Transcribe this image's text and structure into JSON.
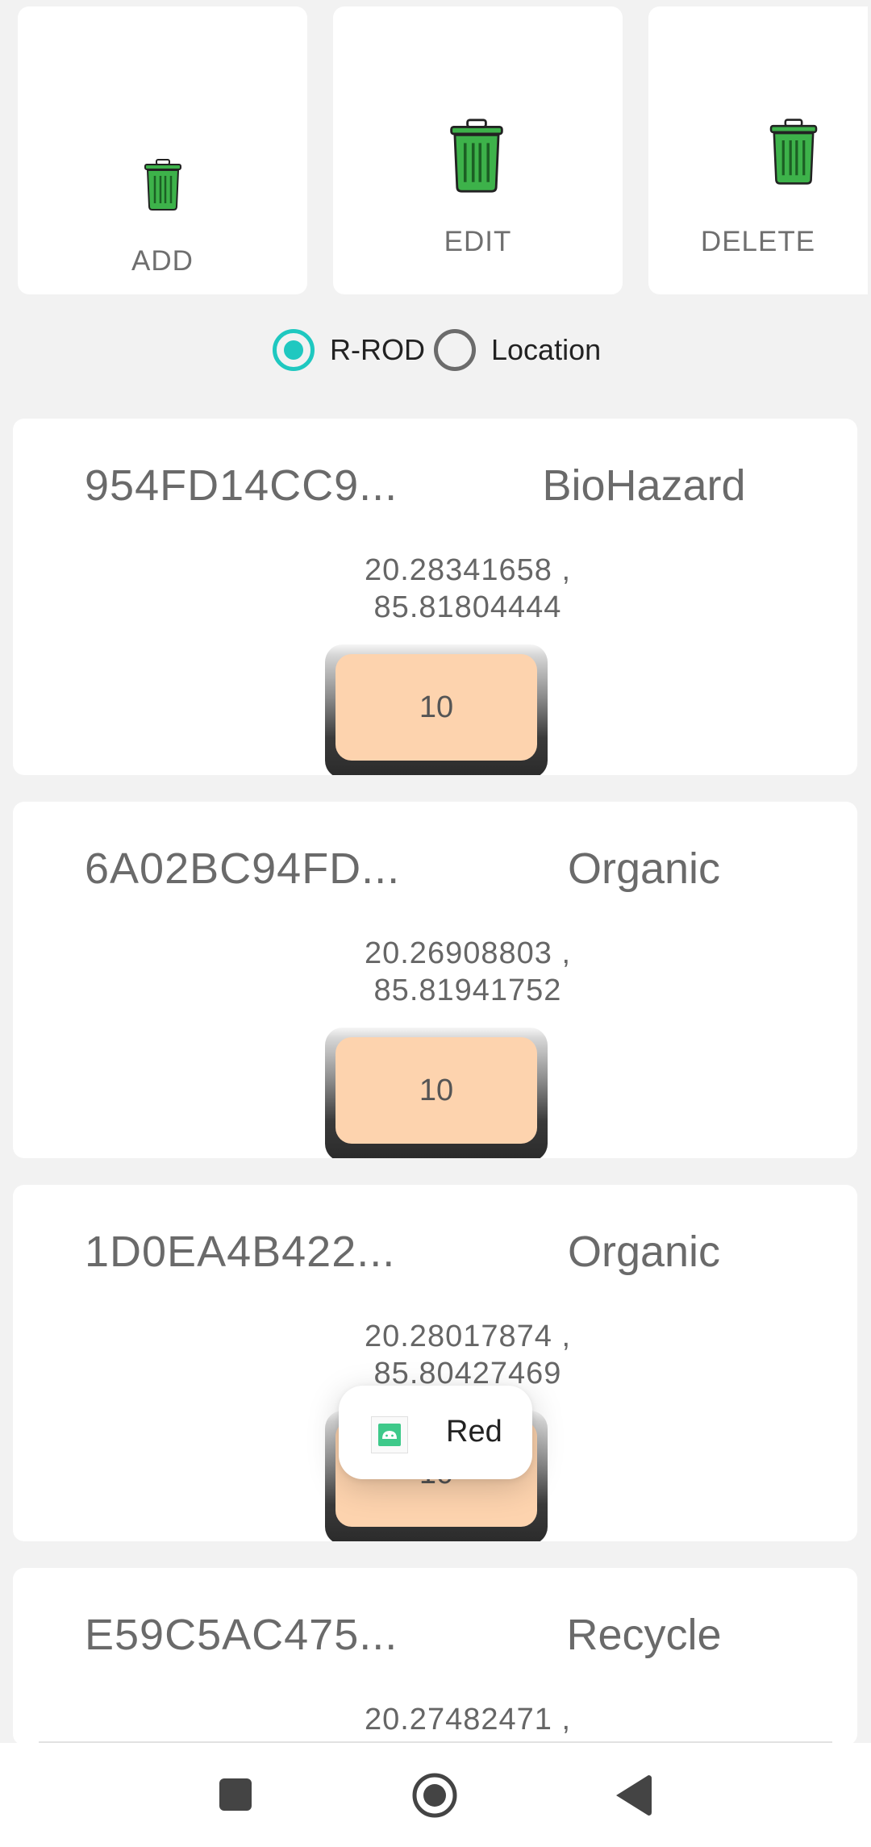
{
  "actions": {
    "add": {
      "label": "ADD",
      "icon": "trash-bin-icon"
    },
    "edit": {
      "label": "EDIT",
      "icon": "trash-bin-icon"
    },
    "delete": {
      "label": "DELETE",
      "icon": "trash-bin-icon"
    }
  },
  "filter": {
    "options": [
      {
        "label": "R-ROD",
        "selected": true
      },
      {
        "label": "Location",
        "selected": false
      }
    ],
    "accent": "#1fc8c0"
  },
  "rods": [
    {
      "id": "954FD14CC9...",
      "type": "BioHazard",
      "lat": "20.28341658 ,",
      "lng": "85.81804444",
      "count": "10"
    },
    {
      "id": "6A02BC94FD...",
      "type": "Organic",
      "lat": "20.26908803 ,",
      "lng": "85.81941752",
      "count": "10"
    },
    {
      "id": "1D0EA4B422...",
      "type": "Organic",
      "lat": "20.28017874 ,",
      "lng": "85.80427469",
      "count": "10"
    },
    {
      "id": "E59C5AC475...",
      "type": "Recycle",
      "lat": "20.27482471 ,",
      "lng": "",
      "count": ""
    }
  ],
  "toast": {
    "text": "Red",
    "icon": "android-app-icon"
  },
  "navbar": {
    "recent": "square-icon",
    "home": "circle-home-icon",
    "back": "triangle-back-icon"
  },
  "colors": {
    "bin_green": "#3db24a",
    "count_button": "#fdd3ae",
    "background": "#f2f2f2"
  }
}
